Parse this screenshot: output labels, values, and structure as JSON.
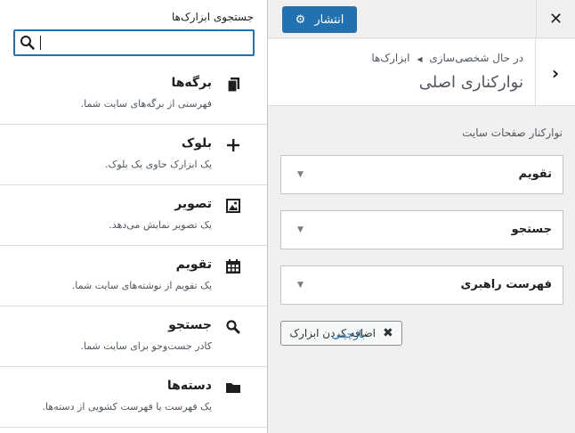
{
  "customizer": {
    "close_label": "✕",
    "publish_label": "انتشار",
    "breadcrumb_part1": "در حال شخصی‌سازی",
    "breadcrumb_part2": "ابزارک‌ها",
    "section_title": "نوارکناری اصلی",
    "area_description": "نوارکنار صفحات سایت",
    "widgets": [
      {
        "title": "تقویم"
      },
      {
        "title": "جستجو"
      },
      {
        "title": "فهرست راهبری"
      }
    ],
    "add_widget_label": "اضافه کردن ابزارک",
    "reorder_label": "بازچینی"
  },
  "picker": {
    "search_label": "جستجوی ابزارک‌ها",
    "search_value": "",
    "items": [
      {
        "name": "برگه‌ها",
        "desc": "فهرستی از برگه‌های سایت شما.",
        "icon": "pages-icon"
      },
      {
        "name": "بلوک",
        "desc": "یک ابزارک حاوی یک بلوک.",
        "icon": "plus-icon"
      },
      {
        "name": "تصویر",
        "desc": "یک تصویر نمایش می‌دهد.",
        "icon": "image-icon"
      },
      {
        "name": "تقویم",
        "desc": "یک تقویم از نوشته‌های سایت شما.",
        "icon": "calendar-icon"
      },
      {
        "name": "جستجو",
        "desc": "کادر جست‌وجو برای سایت شما.",
        "icon": "search-icon"
      },
      {
        "name": "دسته‌ها",
        "desc": "یک فهرست یا فهرست کشویی از دسته‌ها.",
        "icon": "folder-icon"
      }
    ]
  },
  "colors": {
    "accent": "#2271b1",
    "panel_bg": "#f0f0f1",
    "border": "#dcdcde"
  }
}
